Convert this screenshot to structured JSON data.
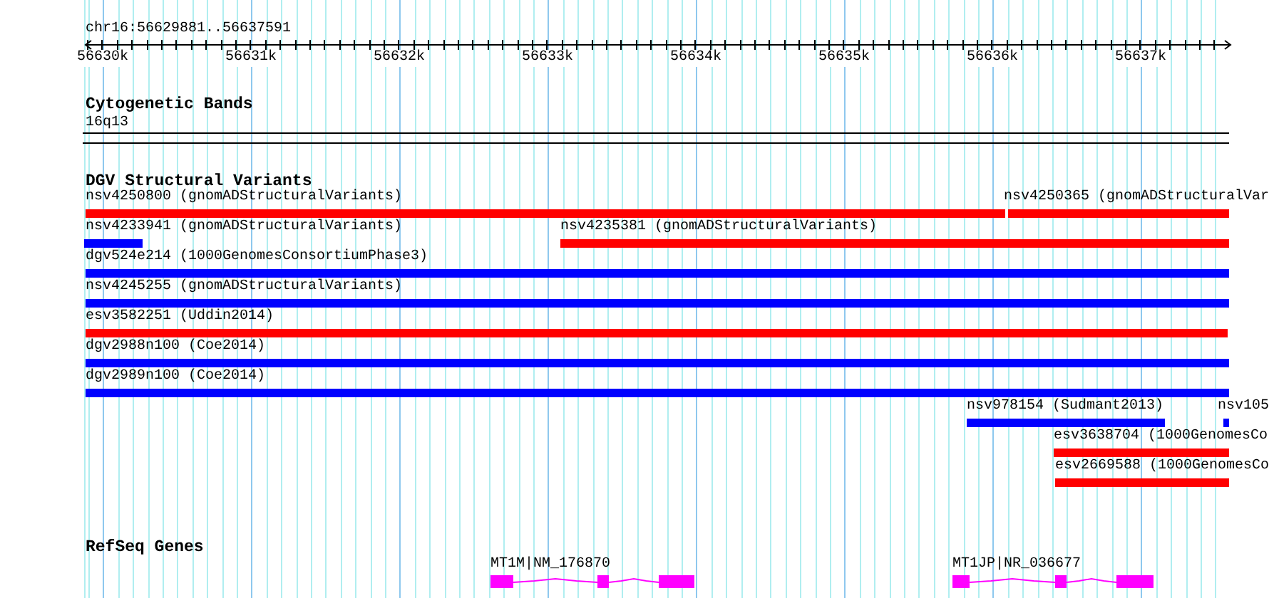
{
  "ruler": {
    "region": "chr16:56629881..56637591",
    "ticks": [
      "56630k",
      "56631k",
      "56632k",
      "56633k",
      "56634k",
      "56635k",
      "56636k",
      "56637k"
    ]
  },
  "tracks": [
    {
      "title": "Cytogenetic Bands",
      "kind": "bands",
      "features": [
        {
          "label": "16q13"
        }
      ]
    },
    {
      "title": "DGV Structural Variants",
      "kind": "variants",
      "features": [
        {
          "label": "nsv4250800 (gnomADStructuralVariants)",
          "color": "#ff0000"
        },
        {
          "label": "nsv4250365 (gnomADStructuralVar",
          "color": "#ff0000"
        },
        {
          "label": "nsv4233941 (gnomADStructuralVariants)",
          "color": "#0000ff"
        },
        {
          "label": "nsv4235381 (gnomADStructuralVariants)",
          "color": "#ff0000"
        },
        {
          "label": "dgv524e214 (1000GenomesConsortiumPhase3)",
          "color": "#0000ff"
        },
        {
          "label": "nsv4245255 (gnomADStructuralVariants)",
          "color": "#0000ff"
        },
        {
          "label": "esv3582251 (Uddin2014)",
          "color": "#ff0000"
        },
        {
          "label": "dgv2988n100 (Coe2014)",
          "color": "#0000ff"
        },
        {
          "label": "dgv2989n100 (Coe2014)",
          "color": "#0000ff"
        },
        {
          "label": "nsv978154 (Sudmant2013)",
          "color": "#0000ff"
        },
        {
          "label": "nsv105",
          "color": "#0000ff"
        },
        {
          "label": "esv3638704 (1000GenomesCo",
          "color": "#ff0000"
        },
        {
          "label": "esv2669588 (1000GenomesCo",
          "color": "#ff0000"
        }
      ]
    },
    {
      "title": "RefSeq Genes",
      "kind": "genes",
      "features": [
        {
          "label": "MT1M|NM_176870"
        },
        {
          "label": "MT1JP|NR_036677"
        }
      ]
    }
  ]
}
